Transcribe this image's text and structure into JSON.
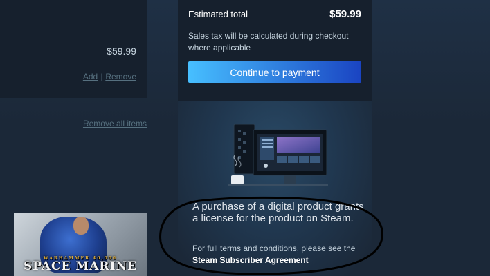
{
  "cart_item": {
    "price": "$59.99",
    "add_label": "Add",
    "separator": "|",
    "remove_label": "Remove"
  },
  "remove_all_label": "Remove all items",
  "game": {
    "logo_top": "WARHAMMER 40,000",
    "logo_text": "SPACE MARINE"
  },
  "summary": {
    "estimated_total_label": "Estimated total",
    "estimated_total_value": "$59.99",
    "tax_note": "Sales tax will be calculated during checkout where applicable",
    "continue_button": "Continue to payment"
  },
  "license": {
    "text": "A purchase of a digital product grants a license for the product on Steam.",
    "terms_prefix": "For full terms and conditions, please see the ",
    "terms_link": "Steam Subscriber Agreement"
  },
  "colors": {
    "background": "#1b2838",
    "panel": "#16202d",
    "button_start": "#47bfff",
    "button_end": "#1a44c2",
    "link_muted": "#56707f"
  }
}
